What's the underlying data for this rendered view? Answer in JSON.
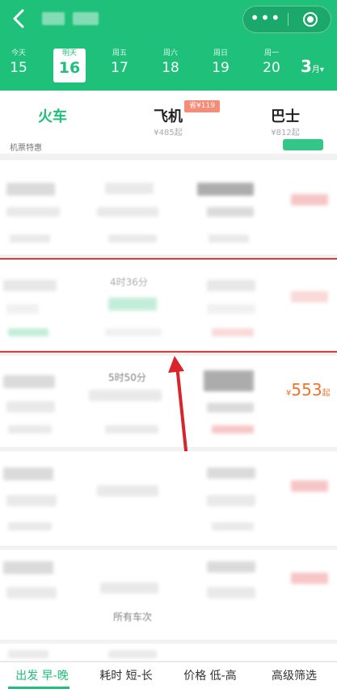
{
  "header": {
    "back_icon": "chevron-left-icon",
    "more_label": "•••",
    "close_icon": "target-close-icon",
    "brand_color": "#1ec07a"
  },
  "date_strip": {
    "days": [
      {
        "weekday": "今天",
        "day": "15"
      },
      {
        "weekday": "明天",
        "day": "16"
      },
      {
        "weekday": "周五",
        "day": "17"
      },
      {
        "weekday": "周六",
        "day": "18"
      },
      {
        "weekday": "周日",
        "day": "19"
      },
      {
        "weekday": "周一",
        "day": "20"
      }
    ],
    "selected_index": 1,
    "month_label": "3",
    "month_suffix": "月▾"
  },
  "mode_tabs": [
    {
      "label": "火车",
      "sub": ""
    },
    {
      "label": "飞机",
      "sub": "¥485起"
    },
    {
      "label": "巴士",
      "sub": "¥812起"
    }
  ],
  "promo_badge": "省¥119",
  "notice_text": "机票特惠",
  "list": {
    "visible_texts": {
      "duration_1": "4时36分",
      "duration_2": "5时50分",
      "price_value": "553",
      "price_prefix": "¥",
      "price_suffix": "起",
      "tag": "所有车次"
    }
  },
  "filters": [
    {
      "label": "出发 早-晚"
    },
    {
      "label": "耗时 短-长"
    },
    {
      "label": "价格 低-高"
    },
    {
      "label": "高级筛选"
    }
  ],
  "accent_colors": {
    "annotation": "#d9242a",
    "price": "#f5702b"
  }
}
